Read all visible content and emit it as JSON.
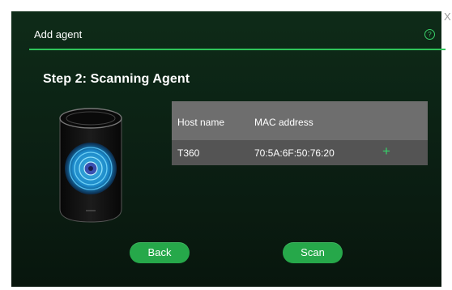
{
  "window": {
    "close_label": "X",
    "title": "Add agent",
    "help_symbol": "?"
  },
  "step": {
    "heading": "Step 2: Scanning Agent"
  },
  "device": {
    "icon": "smart-speaker-icon"
  },
  "table": {
    "columns": [
      "Host name",
      "MAC address"
    ],
    "rows": [
      {
        "host": "T360",
        "mac": "70:5A:6F:50:76:20",
        "action": "+"
      }
    ]
  },
  "buttons": {
    "back": "Back",
    "scan": "Scan"
  },
  "colors": {
    "accent": "#2fc45a",
    "button": "#26a84a",
    "header_bg": "#6e6e6e",
    "row_bg": "#545454",
    "dialog_bg": "#0e2b18"
  }
}
